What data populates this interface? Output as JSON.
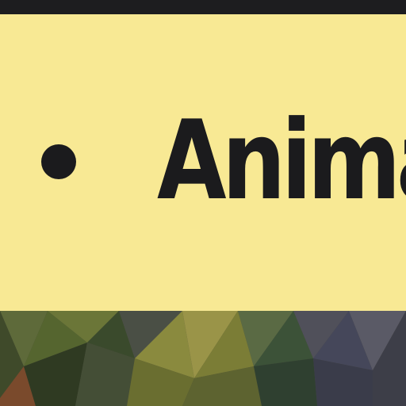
{
  "list": {
    "items": [
      {
        "label": "Anima"
      }
    ]
  },
  "colors": {
    "banner_background": "#f8e994",
    "top_bar": "#1d1d1f",
    "text": "#1b1b1d"
  },
  "icons": {
    "bullet": "bullet-icon"
  }
}
